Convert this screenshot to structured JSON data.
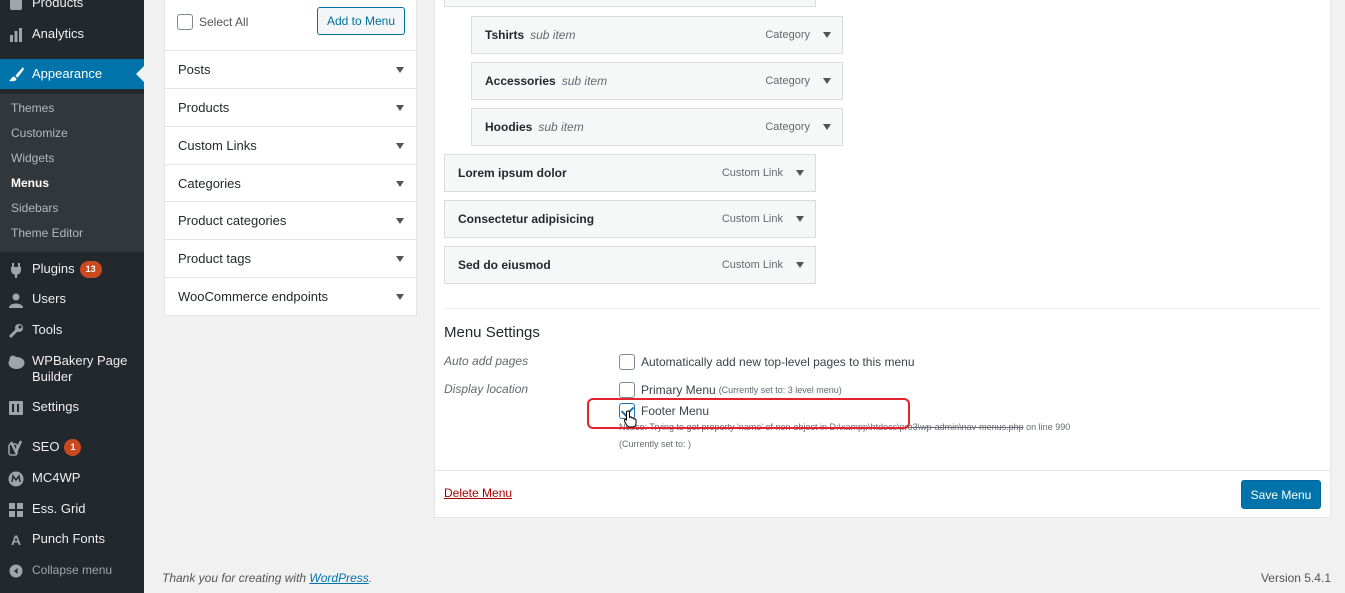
{
  "sidebar": {
    "items": [
      {
        "label": "Products",
        "icon": "products-icon"
      },
      {
        "label": "Analytics",
        "icon": "analytics-icon"
      },
      {
        "label": "Appearance",
        "icon": "appearance-brush-icon"
      },
      {
        "label": "Plugins",
        "icon": "plugins-icon",
        "badge": "13"
      },
      {
        "label": "Users",
        "icon": "users-icon"
      },
      {
        "label": "Tools",
        "icon": "tools-icon"
      },
      {
        "label": "WPBakery Page Builder",
        "icon": "wpbakery-icon"
      },
      {
        "label": "Settings",
        "icon": "settings-icon"
      },
      {
        "label": "SEO",
        "icon": "seo-yoast-icon",
        "badge": "1"
      },
      {
        "label": "MC4WP",
        "icon": "mc4wp-icon"
      },
      {
        "label": "Ess. Grid",
        "icon": "grid-icon"
      },
      {
        "label": "Punch Fonts",
        "icon": "font-icon"
      },
      {
        "label": "Collapse menu",
        "icon": "collapse-icon"
      }
    ],
    "appearance_sub": [
      "Themes",
      "Customize",
      "Widgets",
      "Menus",
      "Sidebars",
      "Theme Editor"
    ],
    "active_sub": "Menus"
  },
  "add_panel": {
    "select_all": "Select All",
    "add_button": "Add to Menu",
    "sections": [
      "Posts",
      "Products",
      "Custom Links",
      "Categories",
      "Product categories",
      "Product tags",
      "WooCommerce endpoints"
    ]
  },
  "menu_items": [
    {
      "title": "Tshirts",
      "sub": "sub item",
      "type": "Category"
    },
    {
      "title": "Accessories",
      "sub": "sub item",
      "type": "Category"
    },
    {
      "title": "Hoodies",
      "sub": "sub item",
      "type": "Category"
    },
    {
      "title": "Lorem ipsum dolor",
      "sub": "",
      "type": "Custom Link"
    },
    {
      "title": "Consectetur adipisicing",
      "sub": "",
      "type": "Custom Link"
    },
    {
      "title": "Sed do eiusmod",
      "sub": "",
      "type": "Custom Link"
    }
  ],
  "settings": {
    "heading": "Menu Settings",
    "auto_add_label": "Auto add pages",
    "auto_add_option": "Automatically add new top-level pages to this menu",
    "display_location_label": "Display location",
    "primary_menu": "Primary Menu",
    "primary_menu_note": "(Currently set to: 3 level menu)",
    "footer_menu": "Footer Menu",
    "notice_prefix": "Notice: Trying to get property 'name' of non-object in D:\\xampp\\htdocs\\pro3\\wp-admin\\nav-menus.php",
    "notice_suffix": "on line 990",
    "footer_current": "(Currently set to: )"
  },
  "actions": {
    "delete": "Delete Menu",
    "save": "Save Menu"
  },
  "footer": {
    "thanks_prefix": "Thank you for creating with ",
    "thanks_link": "WordPress",
    "thanks_suffix": ".",
    "version": "Version 5.4.1"
  },
  "colors": {
    "accent": "#0073aa",
    "sidebar_bg": "#23282d",
    "highlight_box": "#e5232c",
    "badge": "#ca4a1f"
  }
}
